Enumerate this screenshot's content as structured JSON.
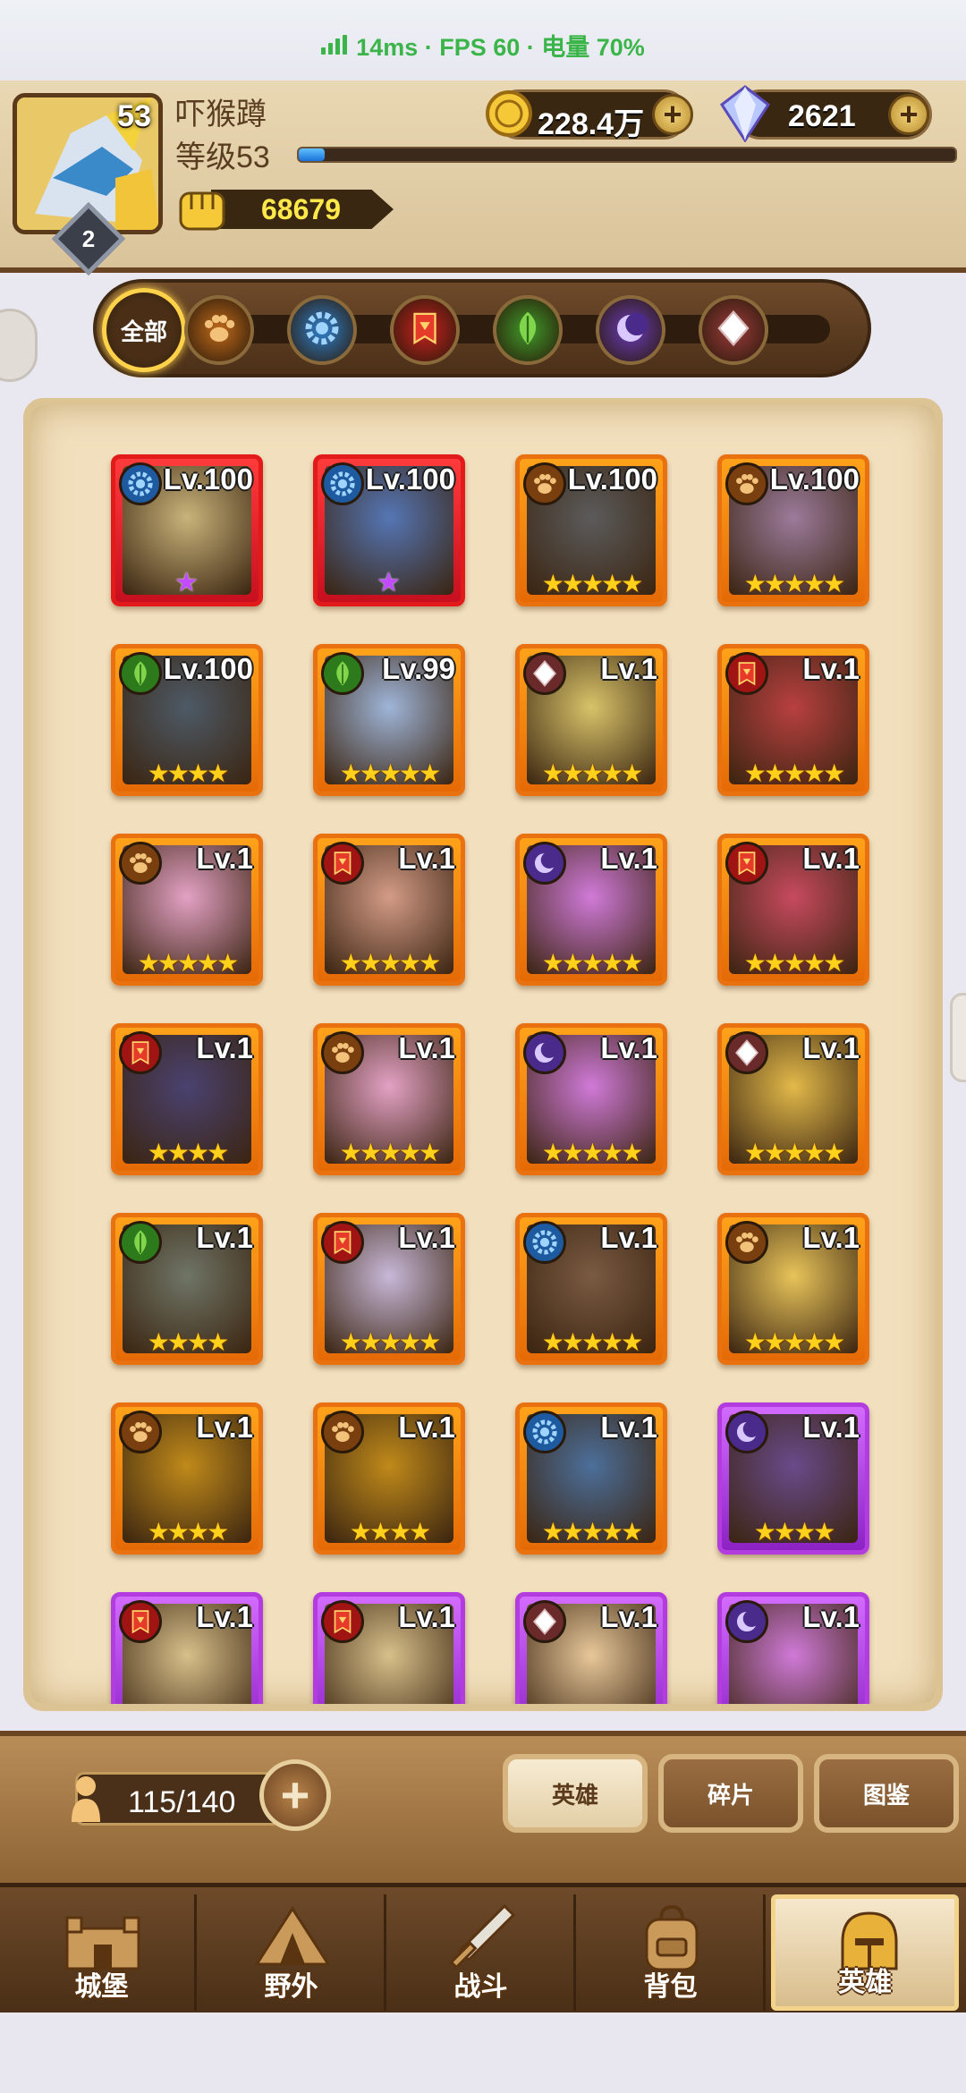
{
  "status_bar": {
    "text": "14ms · FPS 60 · 电量 70%",
    "color": "#3bb54a"
  },
  "player": {
    "avatar_level": "53",
    "rank": "2",
    "name": "吓猴蹲",
    "level_text": "等级53",
    "exp_progress": 0.04,
    "power": "68679"
  },
  "currencies": {
    "gold": "228.4万",
    "gems": "2621",
    "plus_icon": "plus-icon"
  },
  "filters": {
    "all_label": "全部",
    "items": [
      {
        "name": "beast",
        "icon": "paw-icon",
        "color": "#c06a1a"
      },
      {
        "name": "mech",
        "icon": "gear-icon",
        "color": "#2f7fc9"
      },
      {
        "name": "warrior",
        "icon": "banner-icon",
        "color": "#c8211f"
      },
      {
        "name": "nature",
        "icon": "leaf-icon",
        "color": "#3f9a2a"
      },
      {
        "name": "dark",
        "icon": "moon-icon",
        "color": "#6a3bb8"
      },
      {
        "name": "light",
        "icon": "diamond-icon",
        "color": "#9a3a3a"
      }
    ]
  },
  "heroes": [
    {
      "level": "Lv.100",
      "faction": "mech",
      "rarity": "red",
      "stars": "★",
      "star_style": "purple",
      "portrait": "#c9b37a"
    },
    {
      "level": "Lv.100",
      "faction": "mech",
      "rarity": "red",
      "stars": "★",
      "star_style": "purple",
      "portrait": "#5576b5"
    },
    {
      "level": "Lv.100",
      "faction": "beast",
      "rarity": "orange",
      "stars": "★★★★★",
      "star_style": "gold",
      "portrait": "#5b5b5b"
    },
    {
      "level": "Lv.100",
      "faction": "beast",
      "rarity": "orange",
      "stars": "★★★★★",
      "star_style": "gold",
      "portrait": "#9b7b9b"
    },
    {
      "level": "Lv.100",
      "faction": "nature",
      "rarity": "orange",
      "stars": "★★★★",
      "star_style": "gold",
      "portrait": "#4d5a66"
    },
    {
      "level": "Lv.99",
      "faction": "nature",
      "rarity": "orange",
      "stars": "★★★★★",
      "star_style": "gold",
      "portrait": "#9fb5d8"
    },
    {
      "level": "Lv.1",
      "faction": "light",
      "rarity": "orange",
      "stars": "★★★★★",
      "star_style": "gold",
      "portrait": "#d8c36a"
    },
    {
      "level": "Lv.1",
      "faction": "warrior",
      "rarity": "orange",
      "stars": "★★★★★",
      "star_style": "gold",
      "portrait": "#b84040"
    },
    {
      "level": "Lv.1",
      "faction": "beast",
      "rarity": "orange",
      "stars": "★★★★★",
      "star_style": "gold",
      "portrait": "#e3a1c4"
    },
    {
      "level": "Lv.1",
      "faction": "warrior",
      "rarity": "orange",
      "stars": "★★★★★",
      "star_style": "gold",
      "portrait": "#d39b87"
    },
    {
      "level": "Lv.1",
      "faction": "dark",
      "rarity": "orange",
      "stars": "★★★★★",
      "star_style": "gold",
      "portrait": "#d07ad8"
    },
    {
      "level": "Lv.1",
      "faction": "warrior",
      "rarity": "orange",
      "stars": "★★★★★",
      "star_style": "gold",
      "portrait": "#c74a5e"
    },
    {
      "level": "Lv.1",
      "faction": "warrior",
      "rarity": "orange",
      "stars": "★★★★",
      "star_style": "gold",
      "portrait": "#4a4270"
    },
    {
      "level": "Lv.1",
      "faction": "beast",
      "rarity": "orange",
      "stars": "★★★★★",
      "star_style": "gold",
      "portrait": "#e3a1c4"
    },
    {
      "level": "Lv.1",
      "faction": "dark",
      "rarity": "orange",
      "stars": "★★★★★",
      "star_style": "gold",
      "portrait": "#d07ad8"
    },
    {
      "level": "Lv.1",
      "faction": "light",
      "rarity": "orange",
      "stars": "★★★★★",
      "star_style": "gold",
      "portrait": "#e2b94a"
    },
    {
      "level": "Lv.1",
      "faction": "nature",
      "rarity": "orange",
      "stars": "★★★★",
      "star_style": "gold",
      "portrait": "#6f7566"
    },
    {
      "level": "Lv.1",
      "faction": "warrior",
      "rarity": "orange",
      "stars": "★★★★★",
      "star_style": "gold",
      "portrait": "#c8b8d8"
    },
    {
      "level": "Lv.1",
      "faction": "mech",
      "rarity": "orange",
      "stars": "★★★★★",
      "star_style": "gold",
      "portrait": "#7a5a42"
    },
    {
      "level": "Lv.1",
      "faction": "beast",
      "rarity": "orange",
      "stars": "★★★★★",
      "star_style": "gold",
      "portrait": "#e8c45a"
    },
    {
      "level": "Lv.1",
      "faction": "beast",
      "rarity": "orange",
      "stars": "★★★★",
      "star_style": "gold",
      "portrait": "#c08a1a"
    },
    {
      "level": "Lv.1",
      "faction": "beast",
      "rarity": "orange",
      "stars": "★★★★",
      "star_style": "gold",
      "portrait": "#c08a1a"
    },
    {
      "level": "Lv.1",
      "faction": "mech",
      "rarity": "orange",
      "stars": "★★★★★",
      "star_style": "gold",
      "portrait": "#4c6f9a"
    },
    {
      "level": "Lv.1",
      "faction": "dark",
      "rarity": "purple",
      "stars": "★★★★",
      "star_style": "gold",
      "portrait": "#6a4a8a"
    },
    {
      "level": "Lv.1",
      "faction": "warrior",
      "rarity": "purple",
      "stars": "",
      "star_style": "gold",
      "portrait": "#d8c08a"
    },
    {
      "level": "Lv.1",
      "faction": "warrior",
      "rarity": "purple",
      "stars": "",
      "star_style": "gold",
      "portrait": "#d8c08a"
    },
    {
      "level": "Lv.1",
      "faction": "light",
      "rarity": "purple",
      "stars": "",
      "star_style": "gold",
      "portrait": "#e8c89a"
    },
    {
      "level": "Lv.1",
      "faction": "dark",
      "rarity": "purple",
      "stars": "",
      "star_style": "gold",
      "portrait": "#d07ad8"
    }
  ],
  "hero_count": "115/140",
  "tabs": [
    {
      "label": "英雄",
      "active": true
    },
    {
      "label": "碎片",
      "active": false
    },
    {
      "label": "图鉴",
      "active": false
    }
  ],
  "nav": [
    {
      "label": "城堡",
      "icon": "castle-icon",
      "active": false
    },
    {
      "label": "野外",
      "icon": "camp-icon",
      "active": false
    },
    {
      "label": "战斗",
      "icon": "sword-icon",
      "active": false
    },
    {
      "label": "背包",
      "icon": "backpack-icon",
      "active": false
    },
    {
      "label": "英雄",
      "icon": "helmet-icon",
      "active": true
    }
  ]
}
